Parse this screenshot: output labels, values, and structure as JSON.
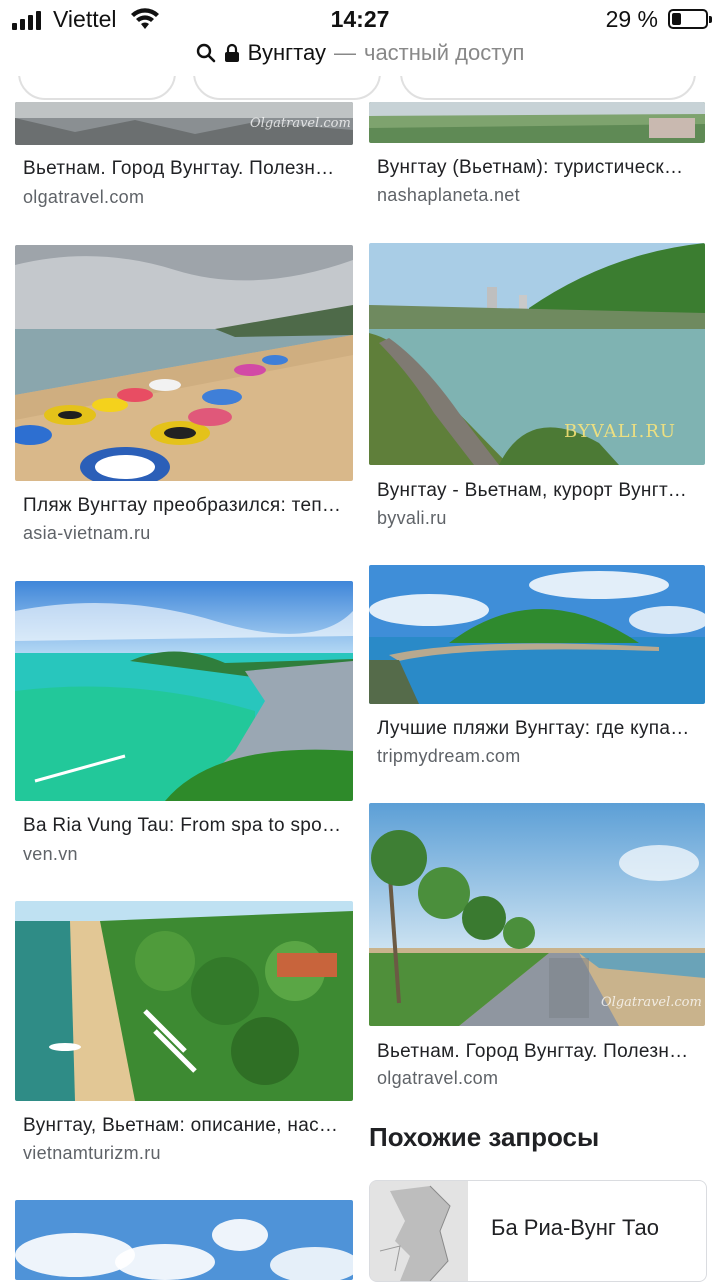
{
  "status_bar": {
    "carrier": "Viettel",
    "time": "14:27",
    "battery_percent": "29 %",
    "battery_level": 0.29,
    "icons": [
      "signal-icon",
      "wifi-icon",
      "battery-icon"
    ]
  },
  "url_bar": {
    "host": "Вунгтау",
    "separator": "—",
    "mode": "частный доступ",
    "icons": [
      "search-icon",
      "lock-icon"
    ]
  },
  "results": [
    {
      "title": "Вьетнам. Город Вунгтау. Полезн…",
      "domain": "olgatravel.com",
      "watermark": "Olgatravel.com"
    },
    {
      "title": "Вунгтау (Вьетнам): туристическ…",
      "domain": "nashaplaneta.net"
    },
    {
      "title": "Пляж Вунгтау преобразился: теп…",
      "domain": "asia-vietnam.ru"
    },
    {
      "title": "Вунгтау - Вьетнам, курорт Вунгта…",
      "domain": "byvali.ru",
      "watermark": "BYVALI.RU"
    },
    {
      "title": "Ba Ria Vung Tau: From spa to spor…",
      "domain": "ven.vn"
    },
    {
      "title": "Лучшие пляжи Вунгтау: где купа…",
      "domain": "tripmydream.com"
    },
    {
      "title": "Вунгтау, Вьетнам: описание, нас…",
      "domain": "vietnamturizm.ru"
    },
    {
      "title": "Вьетнам. Город Вунгтау. Полезн…",
      "domain": "olgatravel.com",
      "watermark": "Olgatravel.com"
    }
  ],
  "related": {
    "heading": "Похожие запросы",
    "items": [
      {
        "label": "Ба Риа-Вунг Тао"
      }
    ]
  }
}
